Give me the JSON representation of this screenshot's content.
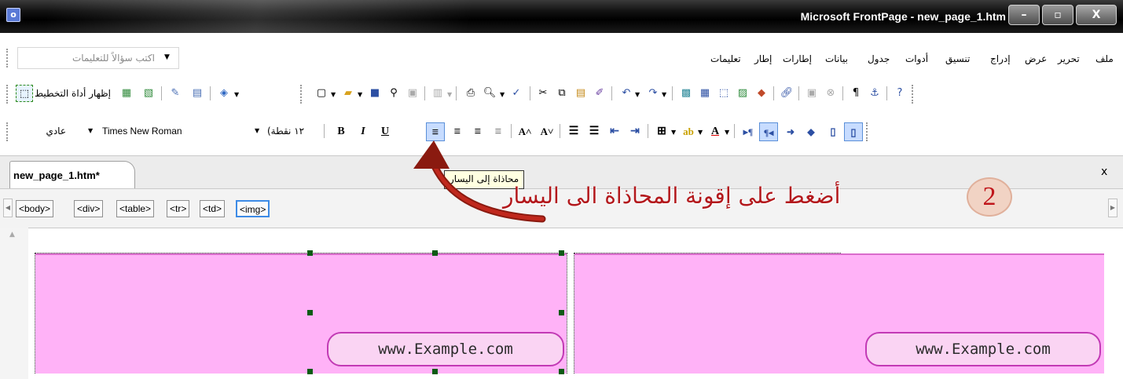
{
  "window": {
    "title": "Microsoft FrontPage - new_page_1.htm",
    "buttons": {
      "minimize": "–",
      "maximize": "▫",
      "close": "X"
    }
  },
  "menu": {
    "items": [
      "ملف",
      "تحرير",
      "عرض",
      "إدراج",
      "تنسيق",
      "أدوات",
      "جدول",
      "بيانات",
      "إطارات",
      "إطار",
      "تعليمات"
    ],
    "help_placeholder": "اكتب سؤالاً للتعليمات"
  },
  "toolbar": {
    "show_layout_tool_label": "إظهار أداة التخطيط"
  },
  "format_toolbar": {
    "style": "عادي",
    "font": "Times New Roman",
    "size": "١٢ نقطة)",
    "bold": "B",
    "italic": "I",
    "underline": "U"
  },
  "tab": {
    "label": "new_page_1.htm*",
    "close": "x"
  },
  "quick_tags": [
    "<body>",
    "<div>",
    "<table>",
    "<tr>",
    "<td>",
    "<img>"
  ],
  "tooltip": "محاذاة إلى اليسار",
  "annotation": {
    "number": "2",
    "text": "أضغط على إقونة المحاذاة الى اليسار"
  },
  "content": {
    "left_url": "www.Example.com",
    "right_url": "www.Example.com"
  },
  "colors": {
    "cell_fill": "#ffb2f7",
    "annotation_red": "#b3181c",
    "selection_handle": "#0b5b14"
  }
}
